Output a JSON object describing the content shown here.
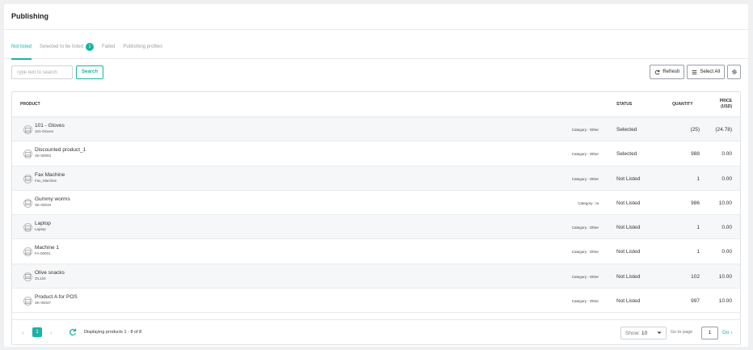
{
  "page": {
    "title": "Publishing"
  },
  "tabs": [
    {
      "label": "Not listed"
    },
    {
      "label": "Selected to be listed",
      "badge": "1"
    },
    {
      "label": "Failed"
    },
    {
      "label": "Publishing profiles"
    }
  ],
  "toolbar": {
    "search_placeholder": "Type text to search",
    "search_label": "Search",
    "refresh_label": "Refresh",
    "select_all_label": "Select All"
  },
  "table": {
    "columns": {
      "product": "PRODUCT",
      "status": "STATUS",
      "quantity": "QUANTITY",
      "price_line1": "PRICE",
      "price_line2": "(USD)"
    },
    "rows": [
      {
        "name": "101 - Gloves",
        "sku": "101-Gloves",
        "category": "Category : Other",
        "status": "Selected",
        "quantity": "(25)",
        "price": "(24.78)"
      },
      {
        "name": "Discounted product_1",
        "sku": "SK-00003",
        "category": "Category : Other",
        "status": "Selected",
        "quantity": "988",
        "price": "0.00"
      },
      {
        "name": "Fax Machine",
        "sku": "Fax_Machine",
        "category": "Category : Other",
        "status": "Not Listed",
        "quantity": "1",
        "price": "0.00"
      },
      {
        "name": "Gummy worms",
        "sku": "SK-00019",
        "category": "Category : Ia",
        "status": "Not Listed",
        "quantity": "986",
        "price": "10.00"
      },
      {
        "name": "Laptop",
        "sku": "Laptop",
        "category": "Category : Other",
        "status": "Not Listed",
        "quantity": "1",
        "price": "0.00"
      },
      {
        "name": "Machine 1",
        "sku": "FA-00001",
        "category": "Category : Other",
        "status": "Not Listed",
        "quantity": "1",
        "price": "0.00"
      },
      {
        "name": "Olive snacks",
        "sku": "OL123",
        "category": "Category : Other",
        "status": "Not Listed",
        "quantity": "102",
        "price": "10.00"
      },
      {
        "name": "Product A for POS",
        "sku": "SK-00037",
        "category": "Category : Other",
        "status": "Not Listed",
        "quantity": "997",
        "price": "10.00"
      }
    ]
  },
  "pagination": {
    "current_page": "1",
    "displaying": "Displaying products 1 - 8 of 8",
    "show_label": "Show:",
    "show_value": "10",
    "goto_label": "Go to page",
    "goto_value": "1",
    "go_label": "Go"
  },
  "colors": {
    "accent": "#1ab3a6"
  }
}
